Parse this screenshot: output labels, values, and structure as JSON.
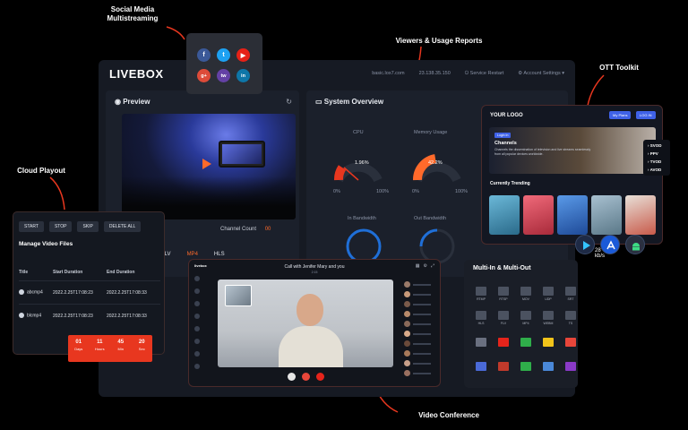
{
  "callouts": {
    "social": "Social Media\nMultistreaming",
    "viewers": "Viewers & Usage Reports",
    "ott": "OTT Toolkit",
    "cloud": "Cloud Playout",
    "vc": "Video Conference"
  },
  "dashboard": {
    "logo": "LIVEBOX",
    "header_items": [
      "basic.lox7.com",
      "23.138.35.150",
      "Service Restart",
      "Account Settings"
    ],
    "preview_title": "Preview",
    "overview_title": "System Overview",
    "cpu_label": "CPU",
    "cpu_value": "1.96%",
    "mem_label": "Memory Usage",
    "mem_value": "42.2%",
    "scale_min": "0%",
    "scale_max": "100%",
    "in_bw": "In Bandwidth",
    "out_bw": "Out Bandwidth",
    "channel_count_label": "Channel Count",
    "channel_count": "00",
    "formats": [
      "FLV",
      "MP4",
      "HLS"
    ],
    "rate": "28 kb/s"
  },
  "playout": {
    "buttons": [
      "START",
      "STOP",
      "SKIP",
      "DELETE ALL"
    ],
    "manage_title": "Manage Video Files",
    "columns": [
      "Title",
      "Start Duration",
      "End Duration"
    ],
    "rows": [
      {
        "title": "abcmp4",
        "start": "2022.2.25T17:08:23",
        "end": "2022.2.25T17:08:33"
      },
      {
        "title": "blcmp4",
        "start": "2022.2.25T17:08:23",
        "end": "2022.2.25T17:08:33"
      }
    ],
    "timer": [
      {
        "num": "01",
        "label": "Days"
      },
      {
        "num": "11",
        "label": "Hours"
      },
      {
        "num": "45",
        "label": "Min"
      },
      {
        "num": "20",
        "label": "Sec"
      }
    ]
  },
  "social": {
    "icons": [
      "f",
      "t",
      "▶",
      "g+",
      "tw",
      "in"
    ],
    "colors": [
      "#3b5998",
      "#1da1f2",
      "#e62117",
      "#dd4b39",
      "#6441a5",
      "#0e76a8"
    ]
  },
  "ott": {
    "logo": "YOUR LOGO",
    "btn1": "My Plans",
    "btn2": "LOG IN",
    "tag": "Login In",
    "channel": "Channels",
    "desc": "Channels the dissemination of television and live streams seamlessly from all popular devices worldwide.",
    "menu": [
      "SVOD",
      "PPV",
      "TVOD",
      "AVOD"
    ],
    "trending": "Currently Trending",
    "thumb_colors": [
      "#4aa3c9",
      "#e8455a",
      "#3b7fd6",
      "#7f9fb9",
      "#c85a4a"
    ]
  },
  "multi": {
    "title": "Multi-In & Multi-Out",
    "items": [
      {
        "label": "RTMP",
        "color": "#4b5260"
      },
      {
        "label": "RTSP",
        "color": "#4b5260"
      },
      {
        "label": "MOV",
        "color": "#4b5260"
      },
      {
        "label": "UDP",
        "color": "#4b5260"
      },
      {
        "label": "SRT",
        "color": "#4b5260"
      },
      {
        "label": "HLS",
        "color": "#4b5260"
      },
      {
        "label": "FLV",
        "color": "#4b5260"
      },
      {
        "label": "MP4",
        "color": "#4b5260"
      },
      {
        "label": "WEBM",
        "color": "#4b5260"
      },
      {
        "label": "TS",
        "color": "#4b5260"
      },
      {
        "label": "",
        "color": "#6a7080"
      },
      {
        "label": "",
        "color": "#e5241b"
      },
      {
        "label": "",
        "color": "#2fae4a"
      },
      {
        "label": "",
        "color": "#f2c41a"
      },
      {
        "label": "",
        "color": "#e8463a"
      },
      {
        "label": "",
        "color": "#4a6ad8"
      },
      {
        "label": "",
        "color": "#c03a2b"
      },
      {
        "label": "",
        "color": "#2fae4a"
      },
      {
        "label": "",
        "color": "#4a88d8"
      },
      {
        "label": "",
        "color": "#8a3ac8"
      }
    ]
  },
  "vc": {
    "brand": "livebox",
    "title": "Call with Jenifer Mary and you",
    "sub": "2:15",
    "ctrl_colors": [
      "#e6e6e6",
      "#e8463a",
      "#e5241b"
    ]
  }
}
